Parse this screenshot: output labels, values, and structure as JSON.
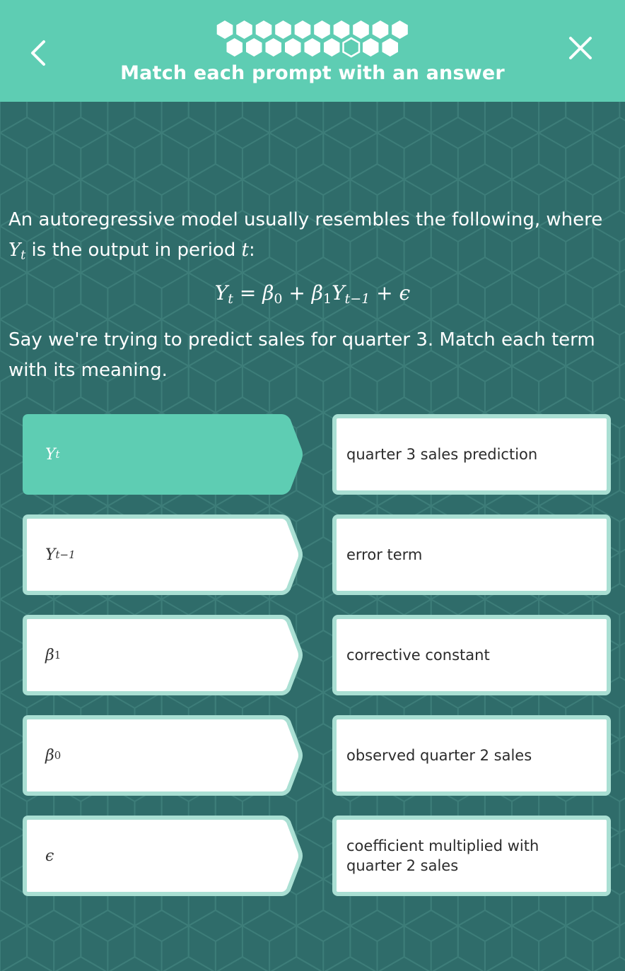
{
  "header": {
    "title": "Match each prompt with an answer",
    "progress": {
      "total": 19,
      "current_index": 13
    },
    "colors": {
      "header_bg": "#5ecdb3",
      "hex_fill": "#ffffff"
    },
    "back_icon": "chevron-left-icon",
    "close_icon": "close-icon"
  },
  "question": {
    "intro_line1": "An autoregressive model usually resembles the following, where",
    "intro_var": "Y",
    "intro_var_sub": "t",
    "intro_line2_mid": " is the output in period ",
    "intro_period": "t",
    "intro_end": ":",
    "formula": {
      "Y": "Y",
      "t": "t",
      "eq": " = ",
      "beta": "β",
      "zero": "0",
      "plus1": " + ",
      "one": "1",
      "t_minus_1": "t−1",
      "plus2": " + ",
      "epsilon": "ϵ"
    },
    "instruction": "Say we're trying to predict sales for quarter 3. Match each term with its meaning."
  },
  "prompts": [
    {
      "main": "Y",
      "sub": "t",
      "selected": true
    },
    {
      "main": "Y",
      "sub": "t−1",
      "selected": false
    },
    {
      "main": "β",
      "sub": "1",
      "selected": false
    },
    {
      "main": "β",
      "sub": "0",
      "selected": false
    },
    {
      "main": "ϵ",
      "sub": "",
      "selected": false
    }
  ],
  "answers": [
    "quarter 3 sales prediction",
    "error term",
    "corrective constant",
    "observed quarter 2 sales",
    "coefficient multiplied with quarter 2 sales"
  ],
  "colors": {
    "background": "#2f6c6a",
    "selected_fill": "#5ecdb3",
    "tile_border": "#a9dfd3",
    "tile_fill": "#ffffff"
  }
}
